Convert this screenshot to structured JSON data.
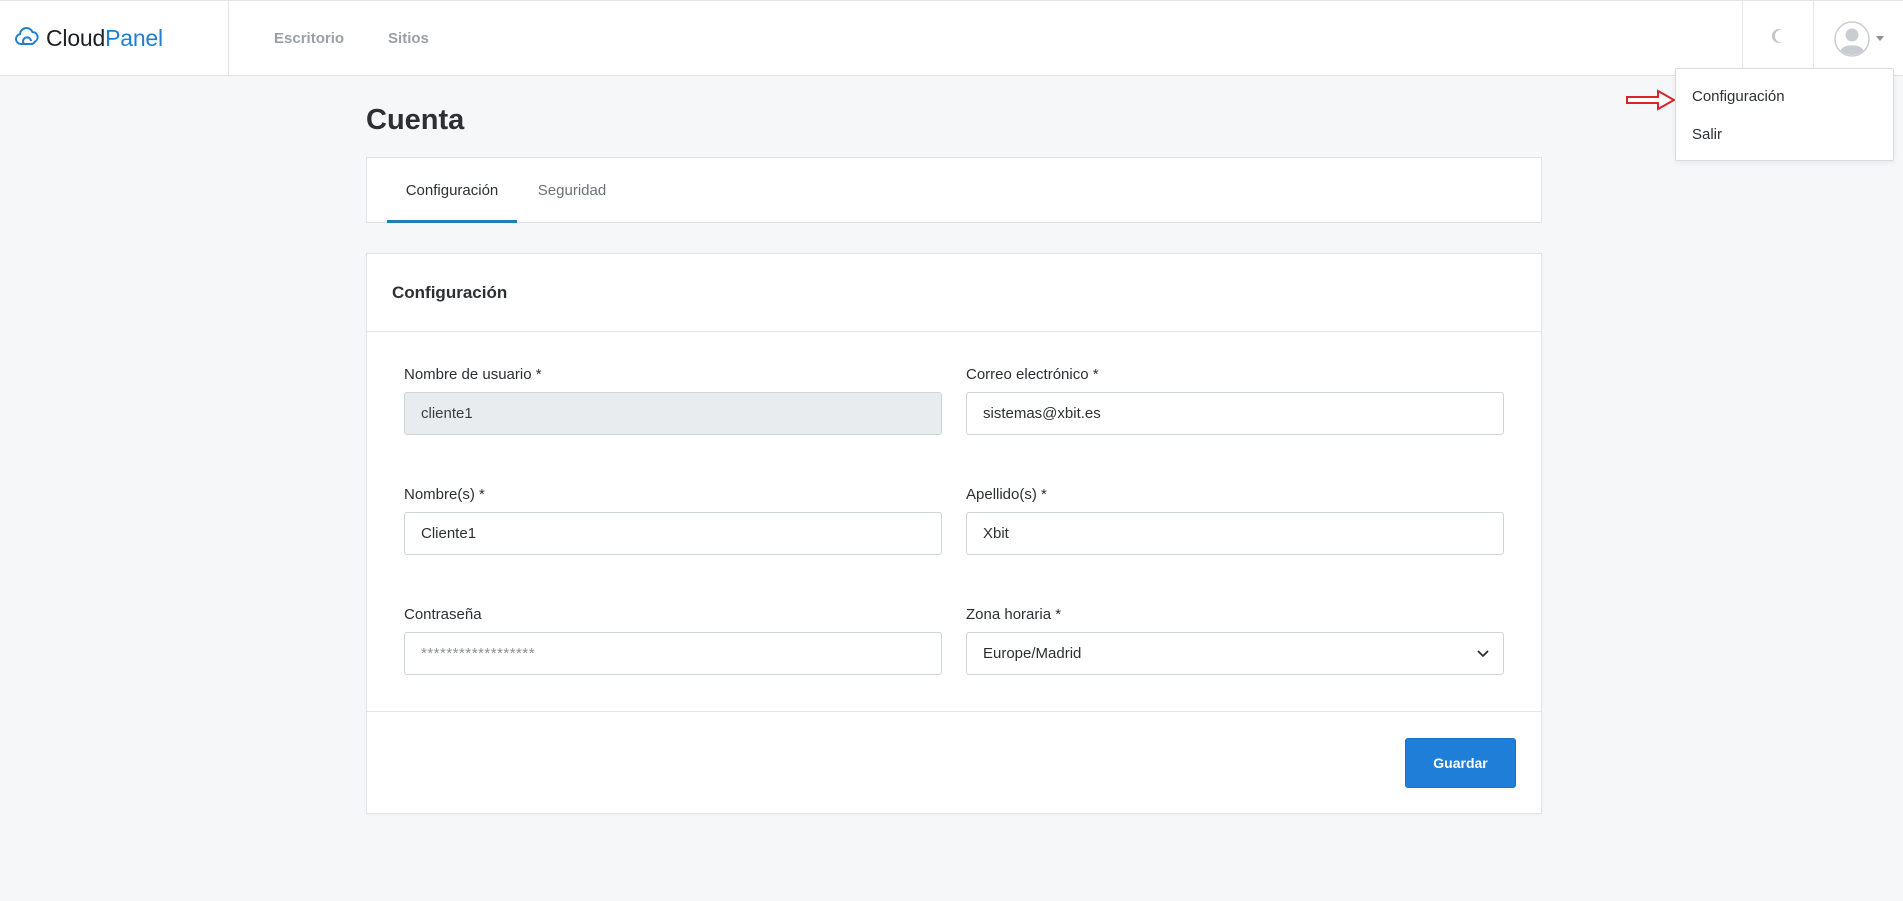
{
  "brand": {
    "cloud": "Cloud",
    "panel": "Panel",
    "icon": "cloud-icon"
  },
  "nav": {
    "items": [
      {
        "label": "Escritorio"
      },
      {
        "label": "Sitios"
      }
    ]
  },
  "header": {
    "theme_icon": "moon-icon",
    "user_icon": "user-avatar-icon"
  },
  "user_dropdown": {
    "items": [
      {
        "label": "Configuración"
      },
      {
        "label": "Salir"
      }
    ]
  },
  "page": {
    "title": "Cuenta",
    "tabs": [
      {
        "label": "Configuración",
        "active": true
      },
      {
        "label": "Seguridad",
        "active": false
      }
    ]
  },
  "form": {
    "title": "Configuración",
    "username": {
      "label": "Nombre de usuario *",
      "value": "cliente1"
    },
    "email": {
      "label": "Correo electrónico *",
      "value": "sistemas@xbit.es"
    },
    "first_name": {
      "label": "Nombre(s) *",
      "value": "Cliente1"
    },
    "last_name": {
      "label": "Apellido(s) *",
      "value": "Xbit"
    },
    "password": {
      "label": "Contraseña",
      "placeholder": "******************"
    },
    "timezone": {
      "label": "Zona horaria *",
      "value": "Europe/Madrid"
    },
    "save_label": "Guardar"
  },
  "colors": {
    "accent": "#1f7fd8",
    "brand_blue": "#1f7fd1",
    "annotation_arrow": "#d9252a"
  }
}
